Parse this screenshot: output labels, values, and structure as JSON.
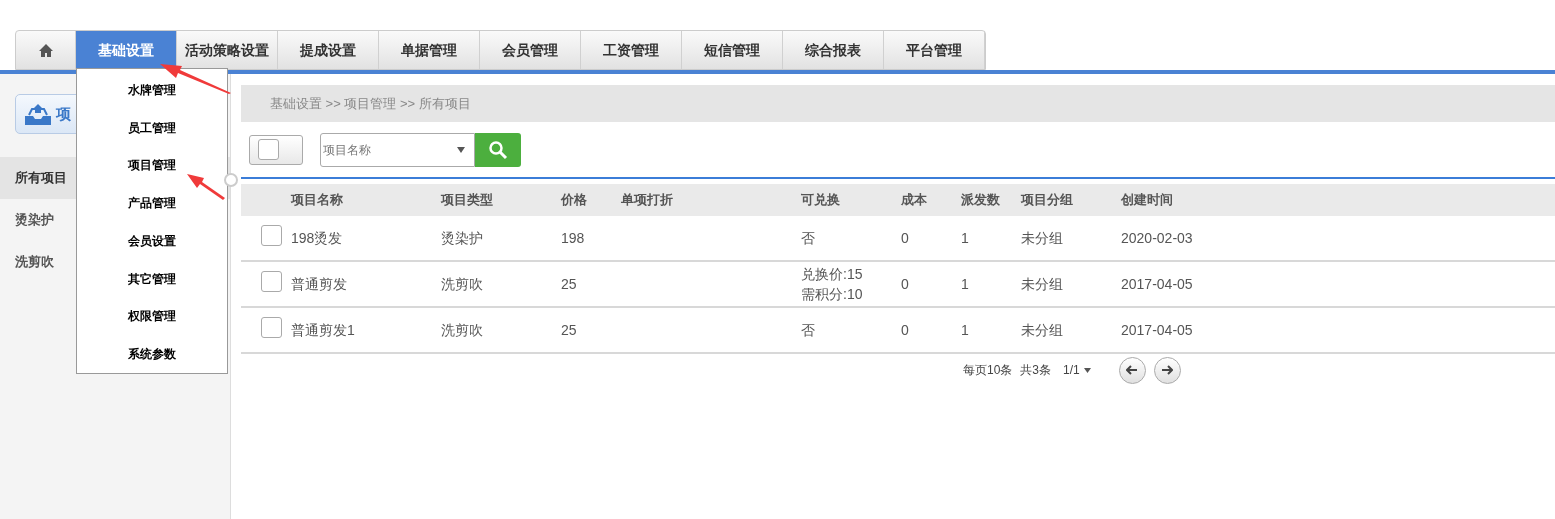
{
  "nav": {
    "tabs": [
      {
        "kind": "home",
        "selected": false
      },
      {
        "kind": "text",
        "label": "基础设置",
        "selected": true
      },
      {
        "kind": "text",
        "label": "活动策略设置",
        "selected": false
      },
      {
        "kind": "text",
        "label": "提成设置",
        "selected": false
      },
      {
        "kind": "text",
        "label": "单据管理",
        "selected": false
      },
      {
        "kind": "text",
        "label": "会员管理",
        "selected": false
      },
      {
        "kind": "text",
        "label": "工资管理",
        "selected": false
      },
      {
        "kind": "text",
        "label": "短信管理",
        "selected": false
      },
      {
        "kind": "text",
        "label": "综合报表",
        "selected": false
      },
      {
        "kind": "text",
        "label": "平台管理",
        "selected": false
      }
    ]
  },
  "dropdown": {
    "items": [
      "水牌管理",
      "员工管理",
      "项目管理",
      "产品管理",
      "会员设置",
      "其它管理",
      "权限管理",
      "系统参数"
    ]
  },
  "sidebar": {
    "add_button": "项",
    "items": [
      {
        "label": "所有项目",
        "selected": true
      },
      {
        "label": "烫染护",
        "selected": false
      },
      {
        "label": "洗剪吹",
        "selected": false
      }
    ]
  },
  "breadcrumb": "基础设置 >> 项目管理 >> 所有项目",
  "filter": {
    "select_all": false,
    "placeholder": "项目名称"
  },
  "table": {
    "columns": [
      "项目名称",
      "项目类型",
      "价格",
      "单项打折",
      "可兑换",
      "成本",
      "派发数",
      "项目分组",
      "创建时间"
    ],
    "rows": [
      {
        "checked": false,
        "cells": [
          [
            "198烫发"
          ],
          [
            "烫染护"
          ],
          [
            "198"
          ],
          [],
          [
            "否"
          ],
          [
            "0"
          ],
          [
            "1"
          ],
          [
            "未分组"
          ],
          [
            "2020-02-03"
          ]
        ]
      },
      {
        "checked": false,
        "cells": [
          [
            "普通剪发"
          ],
          [
            "洗剪吹"
          ],
          [
            "25"
          ],
          [],
          [
            "兑换价:15",
            "需积分:10"
          ],
          [
            "0"
          ],
          [
            "1"
          ],
          [
            "未分组"
          ],
          [
            "2017-04-05"
          ]
        ]
      },
      {
        "checked": false,
        "cells": [
          [
            "普通剪发1"
          ],
          [
            "洗剪吹"
          ],
          [
            "25"
          ],
          [],
          [
            "否"
          ],
          [
            "0"
          ],
          [
            "1"
          ],
          [
            "未分组"
          ],
          [
            "2017-04-05"
          ]
        ]
      }
    ]
  },
  "pagination": {
    "page_size": "每页10条",
    "total": "共3条",
    "page": "1/1"
  }
}
